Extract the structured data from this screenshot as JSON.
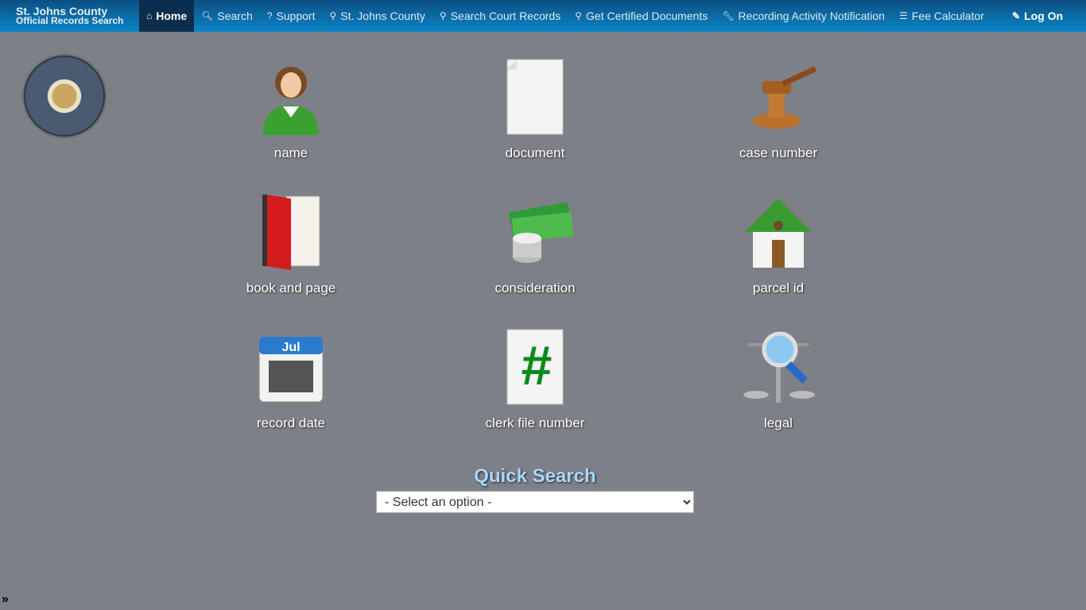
{
  "brand": {
    "line1": "St. Johns County",
    "line2": "Official Records Search"
  },
  "nav": [
    {
      "label": "Home",
      "icon": "home-icon",
      "active": true
    },
    {
      "label": "Search",
      "icon": "search-icon"
    },
    {
      "label": "Support",
      "icon": "question-icon"
    },
    {
      "label": "St. Johns County",
      "icon": "map-marker-icon"
    },
    {
      "label": "Search Court Records",
      "icon": "map-marker-icon"
    },
    {
      "label": "Get Certified Documents",
      "icon": "map-marker-icon"
    },
    {
      "label": "Recording Activity Notification",
      "icon": "wrench-icon"
    },
    {
      "label": "Fee Calculator",
      "icon": "list-icon"
    }
  ],
  "logon": {
    "label": "Log On",
    "icon": "pencil-icon"
  },
  "tiles": [
    {
      "label": "name",
      "icon": "person-icon"
    },
    {
      "label": "document",
      "icon": "document-icon"
    },
    {
      "label": "case number",
      "icon": "gavel-icon"
    },
    {
      "label": "book and page",
      "icon": "book-icon"
    },
    {
      "label": "consideration",
      "icon": "money-icon"
    },
    {
      "label": "parcel id",
      "icon": "house-icon"
    },
    {
      "label": "record date",
      "icon": "calendar-icon",
      "month": "Jul"
    },
    {
      "label": "clerk file number",
      "icon": "hash-document-icon",
      "glyph": "#"
    },
    {
      "label": "legal",
      "icon": "scales-magnifier-icon"
    }
  ],
  "quick_search": {
    "title": "Quick Search",
    "selected": "- Select an option -"
  },
  "toggle": "»"
}
